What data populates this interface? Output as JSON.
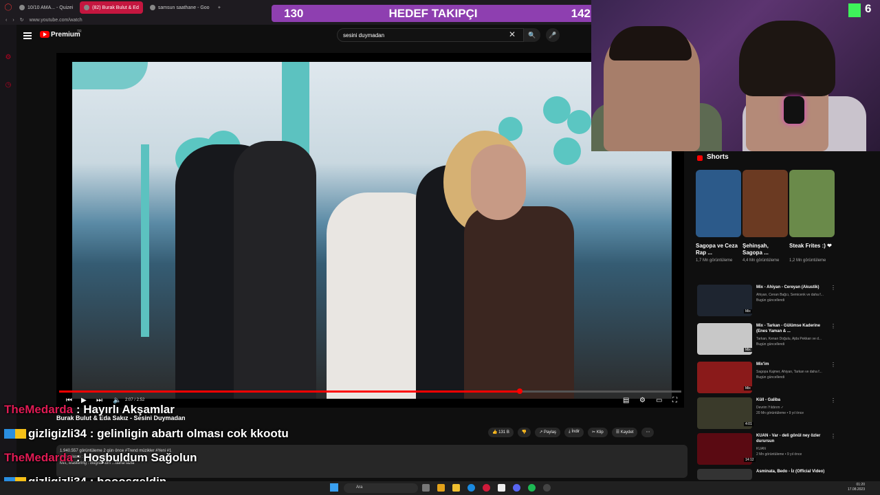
{
  "browser": {
    "tabs": [
      {
        "label": "10/10 AMA... - Quizei"
      },
      {
        "label": "(82) Burak Bulut & Ed"
      },
      {
        "label": "samsun saathane - Goo"
      }
    ],
    "url": "www.youtube.com/watch"
  },
  "youtube": {
    "brand": "Premium",
    "region": "TR",
    "search_value": "sesini duymadan"
  },
  "overlay": {
    "goal_current": "130",
    "goal_title": "HEDEF TAKIPÇI",
    "goal_target": "142",
    "kick_count": "6"
  },
  "player": {
    "time": "2:07 / 2:52",
    "progress_fraction": 0.74
  },
  "video": {
    "title": "Burak Bulut & Eda Sakız - Sesini Duymadan",
    "likes": "131 B",
    "actions": [
      "Paylaş",
      "İndir",
      "Klip",
      "Kaydet"
    ],
    "description_lines": [
      "1.940.557 görüntüleme  2 gün önce  #Trend müzikler #Yeni  #1",
      "Düzenleme : Denizkan Boz",
      "Mix, Mastering : Buğra Kum ...daha fazla"
    ]
  },
  "sidebar": {
    "shorts_label": "Shorts",
    "shorts": [
      {
        "title": "Sagopa ve Ceza Rap ...",
        "views": "1,7 Mn görüntüleme",
        "color": "#2c5a8a"
      },
      {
        "title": "Şehinşah, Sagopa ...",
        "views": "4,4 Mn görüntüleme",
        "color": "#6b3a22"
      },
      {
        "title": "Steak Frites :) ❤",
        "views": "1,2 Mn görüntüleme",
        "color": "#6a8a4a"
      }
    ],
    "recommendations": [
      {
        "title": "Mix - Ahiyan - Cereyan (Akustik)",
        "meta1": "Ahiyan, Cenan Bağcı, Semicenk ve daha f...",
        "meta2": "Bugün güncellendi",
        "tag": "Mix",
        "color": "#1e2530"
      },
      {
        "title": "Mix - Tarkan - Gülümse Kaderine (Enes Yaman & ...",
        "meta1": "Tarkan, Kenan Doğulu, Ajda Pekkan ve d...",
        "meta2": "Bugün güncellendi",
        "tag": "Mix",
        "color": "#c8c8c8"
      },
      {
        "title": "Mix'im",
        "meta1": "Sagopa Kajmer, Ahiyan, Tarkan ve daha f...",
        "meta2": "Bugün güncellendi",
        "tag": "Mix",
        "color": "#8a1a1a"
      },
      {
        "title": "Küll - Galiba",
        "meta1": "Devrim Yıldırım ✓",
        "meta2": "20 Mn görüntüleme • 9 yıl önce",
        "tag": "4:01",
        "color": "#3a3a2a"
      },
      {
        "title": "KUAN - Var - deli gönül ney özler durursun",
        "meta1": "KUAN",
        "meta2": "2 Mn görüntüleme • 9 yıl önce",
        "tag": "14:12",
        "color": "#5a0a12"
      },
      {
        "title": "Asminata, Bedo - İz (Official Video)",
        "meta1": "",
        "meta2": "",
        "tag": "",
        "color": "#333333"
      }
    ]
  },
  "chat": [
    {
      "user": "TheMedarda",
      "message": ": Hayırlı Akşamlar",
      "badges": false
    },
    {
      "user": "gizligizli34",
      "message": ": gelinligin abartı olması cok kkootu",
      "badges": true
    },
    {
      "user": "TheMedarda",
      "message": ": Hoşbuldum Sağolun",
      "badges": false
    },
    {
      "user": "gizligizli34",
      "message": ": hooosgeldin",
      "badges": true
    }
  ],
  "taskbar": {
    "search_label": "Ara",
    "time": "01:20",
    "date": "17.08.2023"
  }
}
